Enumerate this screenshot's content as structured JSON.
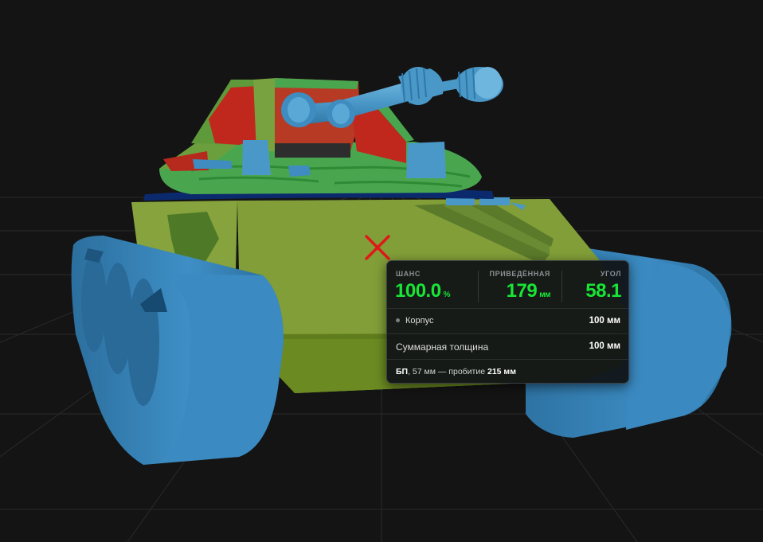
{
  "scene": {
    "background": "#141414",
    "grid_color": "#2a2a2a",
    "track_color": "#3a89c0",
    "hull_color": "#7d9a3a",
    "turret_green": "#4caf50",
    "turret_red": "#c0281e",
    "gun_color": "#4a98c8",
    "aim_marker": {
      "icon": "x-mark-icon",
      "color": "#e01818"
    }
  },
  "info_panel": {
    "chance": {
      "label": "ШАНС",
      "value": "100.0",
      "unit": "%"
    },
    "reduced_armor": {
      "label": "ПРИВЕДЁННАЯ",
      "value": "179",
      "unit": "мм"
    },
    "angle": {
      "label": "УГОЛ",
      "value": "58.1"
    },
    "hull": {
      "label": "Корпус",
      "value": "100 мм"
    },
    "total_thickness": {
      "label": "Суммарная толщина",
      "value": "100 мм"
    },
    "shell": {
      "type": "БП",
      "caliber_text": ", 57 мм — пробитие ",
      "penetration": "215 мм"
    },
    "colors": {
      "value_green": "#18e636",
      "label_gray": "#8b8f92"
    }
  }
}
